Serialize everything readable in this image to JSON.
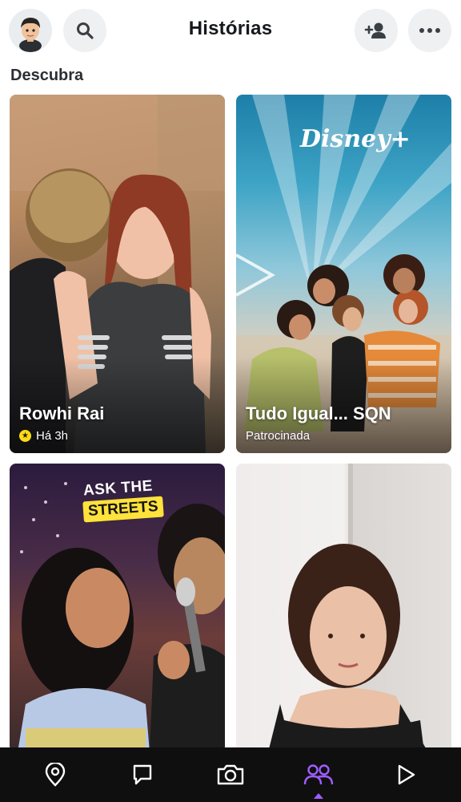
{
  "header": {
    "title": "Histórias"
  },
  "section": {
    "label": "Descubra"
  },
  "cards": [
    {
      "title": "Rowhi Rai",
      "subtitle": "Há 3h"
    },
    {
      "title": "Tudo Igual... SQN",
      "subtitle": "Patrocinada",
      "logo_text": "Disney+"
    },
    {
      "title": "",
      "subtitle": "",
      "badge_line1": "ASK THE",
      "badge_line2": "STREETS"
    },
    {
      "title": "",
      "subtitle": ""
    }
  ],
  "nav": {
    "items": [
      "map-icon",
      "chat-icon",
      "camera-icon",
      "stories-icon",
      "spotlight-icon"
    ],
    "active": "stories-icon"
  },
  "colors": {
    "accent": "#a05dff",
    "nav_bg": "#0f0f10",
    "star_badge": "#ffdb15",
    "streets_badge": "#ffe23a"
  }
}
